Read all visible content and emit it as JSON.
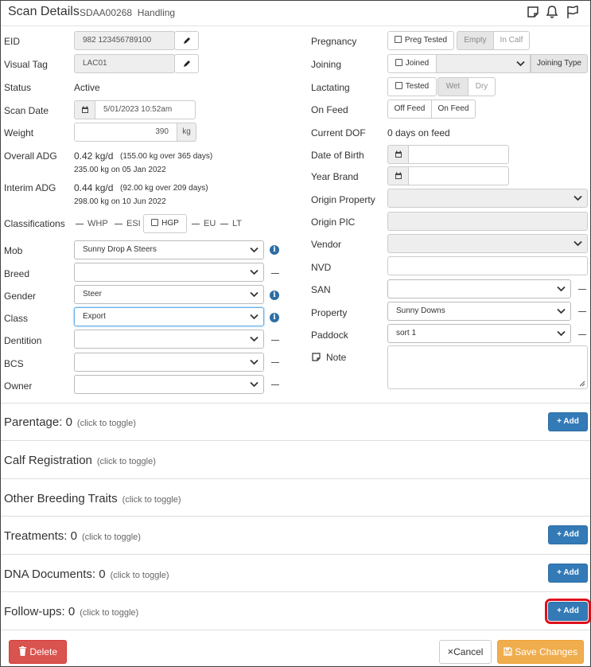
{
  "header": {
    "title": "Scan Details",
    "subtitle_id": "SDAA00268",
    "subtitle_mode": "Handling"
  },
  "left": {
    "eid": {
      "label": "EID",
      "value": "982 123456789100"
    },
    "visual_tag": {
      "label": "Visual Tag",
      "value": "LAC01"
    },
    "status": {
      "label": "Status",
      "value": "Active"
    },
    "scan_date": {
      "label": "Scan Date",
      "value": "5/01/2023 10:52am"
    },
    "weight": {
      "label": "Weight",
      "value": "390",
      "unit": "kg"
    },
    "overall_adg": {
      "label": "Overall ADG",
      "value": "0.42 kg/d",
      "detail": "(155.00 kg over 365 days)",
      "sub": "235.00 kg on 05 Jan 2022"
    },
    "interim_adg": {
      "label": "Interim ADG",
      "value": "0.44 kg/d",
      "detail": "(92.00 kg over 209 days)",
      "sub": "298.00 kg on 10 Jun 2022"
    },
    "classifications": {
      "label": "Classifications",
      "whp": "WHP",
      "esi": "ESI",
      "hgp": "HGP",
      "eu": "EU",
      "lt": "LT"
    },
    "mob": {
      "label": "Mob",
      "value": "Sunny Drop A Steers"
    },
    "breed": {
      "label": "Breed",
      "value": ""
    },
    "gender": {
      "label": "Gender",
      "value": "Steer"
    },
    "class": {
      "label": "Class",
      "value": "Export"
    },
    "dentition": {
      "label": "Dentition",
      "value": ""
    },
    "bcs": {
      "label": "BCS",
      "value": ""
    },
    "owner": {
      "label": "Owner",
      "value": ""
    }
  },
  "right": {
    "pregnancy": {
      "label": "Pregnancy",
      "check": "Preg Tested",
      "opt1": "Empty",
      "opt2": "In Calf"
    },
    "joining": {
      "label": "Joining",
      "check": "Joined",
      "type_button": "Joining Type"
    },
    "lactating": {
      "label": "Lactating",
      "check": "Tested",
      "opt1": "Wet",
      "opt2": "Dry"
    },
    "on_feed": {
      "label": "On Feed",
      "opt1": "Off Feed",
      "opt2": "On Feed"
    },
    "current_dof": {
      "label": "Current DOF",
      "value": "0 days on feed"
    },
    "date_of_birth": {
      "label": "Date of Birth",
      "value": ""
    },
    "year_brand": {
      "label": "Year Brand",
      "value": ""
    },
    "origin_property": {
      "label": "Origin Property",
      "value": ""
    },
    "origin_pic": {
      "label": "Origin PIC",
      "value": ""
    },
    "vendor": {
      "label": "Vendor",
      "value": ""
    },
    "nvd": {
      "label": "NVD",
      "value": ""
    },
    "san": {
      "label": "SAN",
      "value": ""
    },
    "property": {
      "label": "Property",
      "value": "Sunny Downs"
    },
    "paddock": {
      "label": "Paddock",
      "value": "sort 1"
    },
    "note": {
      "label": "Note",
      "value": ""
    }
  },
  "sections": [
    {
      "title": "Parentage:",
      "count": "0",
      "hint": "(click to toggle)",
      "add": "Add"
    },
    {
      "title": "Calf Registration",
      "count": "",
      "hint": "(click to toggle)",
      "add": ""
    },
    {
      "title": "Other Breeding Traits",
      "count": "",
      "hint": "(click to toggle)",
      "add": ""
    },
    {
      "title": "Treatments:",
      "count": "0",
      "hint": "(click to toggle)",
      "add": "Add"
    },
    {
      "title": "DNA Documents:",
      "count": "0",
      "hint": "(click to toggle)",
      "add": "Add"
    },
    {
      "title": "Follow-ups:",
      "count": "0",
      "hint": "(click to toggle)",
      "add": "Add"
    }
  ],
  "footer": {
    "delete": "Delete",
    "cancel": "Cancel",
    "save": "Save Changes"
  },
  "colors": {
    "primary": "#337ab7",
    "danger": "#d9534f",
    "warning": "#f0ad4e",
    "highlight": "#e0101c"
  },
  "icons": [
    "pencil-icon",
    "calendar-icon",
    "chevron-down-icon",
    "info-icon",
    "note-icon",
    "bell-icon",
    "flag-icon",
    "trash-icon",
    "save-icon"
  ]
}
